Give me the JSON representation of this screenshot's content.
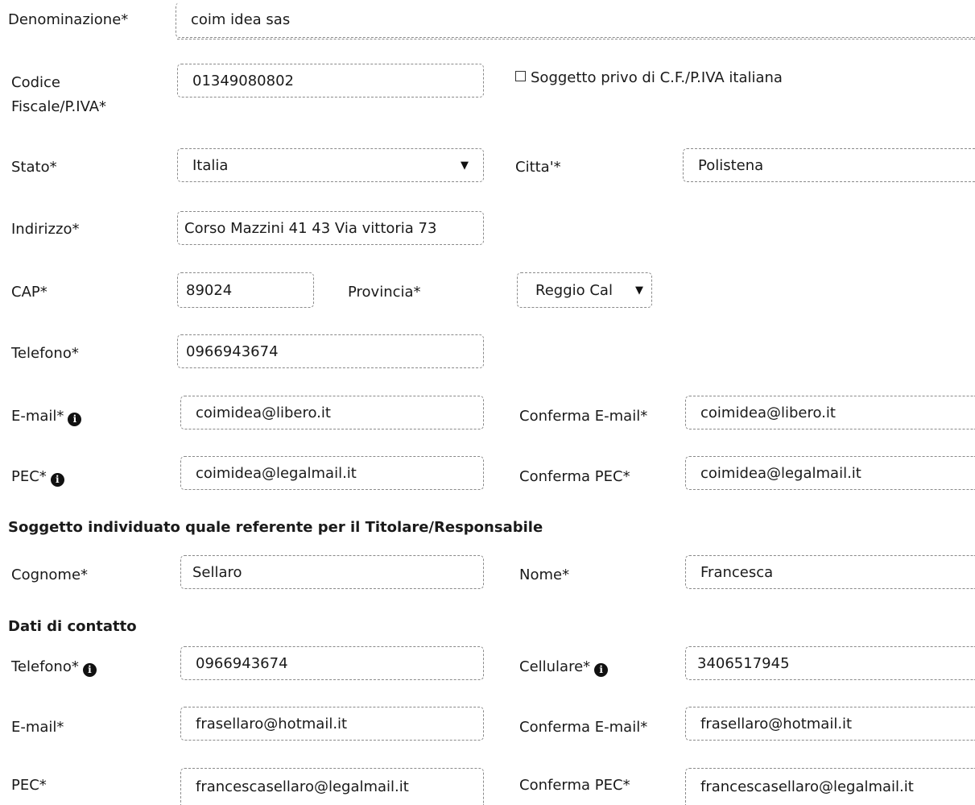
{
  "company": {
    "denominazione_label": "Denominazione*",
    "denominazione_value": "coim idea sas",
    "cf_label_1": "Codice",
    "cf_label_2": "Fiscale/P.IVA*",
    "cf_value": "01349080802",
    "no_cf_label": "Soggetto privo di C.F./P.IVA italiana",
    "stato_label": "Stato*",
    "stato_value": "Italia",
    "citta_label": "Citta'*",
    "citta_value": "Polistena",
    "indirizzo_label": "Indirizzo*",
    "indirizzo_value": "Corso Mazzini  41 43 Via vittoria 73",
    "cap_label": "CAP*",
    "cap_value": "89024",
    "provincia_label": "Provincia*",
    "provincia_value": "Reggio Cal",
    "telefono_label": "Telefono*",
    "telefono_value": "0966943674",
    "email_label": "E-mail*",
    "email_value": "coimidea@libero.it",
    "confirm_email_label": "Conferma E-mail*",
    "confirm_email_value": "coimidea@libero.it",
    "pec_label": "PEC*",
    "pec_value": "coimidea@legalmail.it",
    "confirm_pec_label": "Conferma PEC*",
    "confirm_pec_value": "coimidea@legalmail.it"
  },
  "referente": {
    "section_title": "Soggetto individuato quale referente per il Titolare/Responsabile",
    "cognome_label": "Cognome*",
    "cognome_value": "Sellaro",
    "nome_label": "Nome*",
    "nome_value": "Francesca"
  },
  "contatto": {
    "section_title": "Dati di contatto",
    "telefono_label": "Telefono*",
    "telefono_value": "0966943674",
    "cellulare_label": "Cellulare*",
    "cellulare_value": "3406517945",
    "email_label": "E-mail*",
    "email_value": "frasellaro@hotmail.it",
    "confirm_email_label": "Conferma E-mail*",
    "confirm_email_value": "frasellaro@hotmail.it",
    "pec_label": "PEC*",
    "pec_value": "francescasellaro@legalmail.it",
    "confirm_pec_label": "Conferma PEC*",
    "confirm_pec_value": "francescasellaro@legalmail.it"
  },
  "icons": {
    "info_glyph": "i",
    "dropdown_glyph": "▼"
  }
}
